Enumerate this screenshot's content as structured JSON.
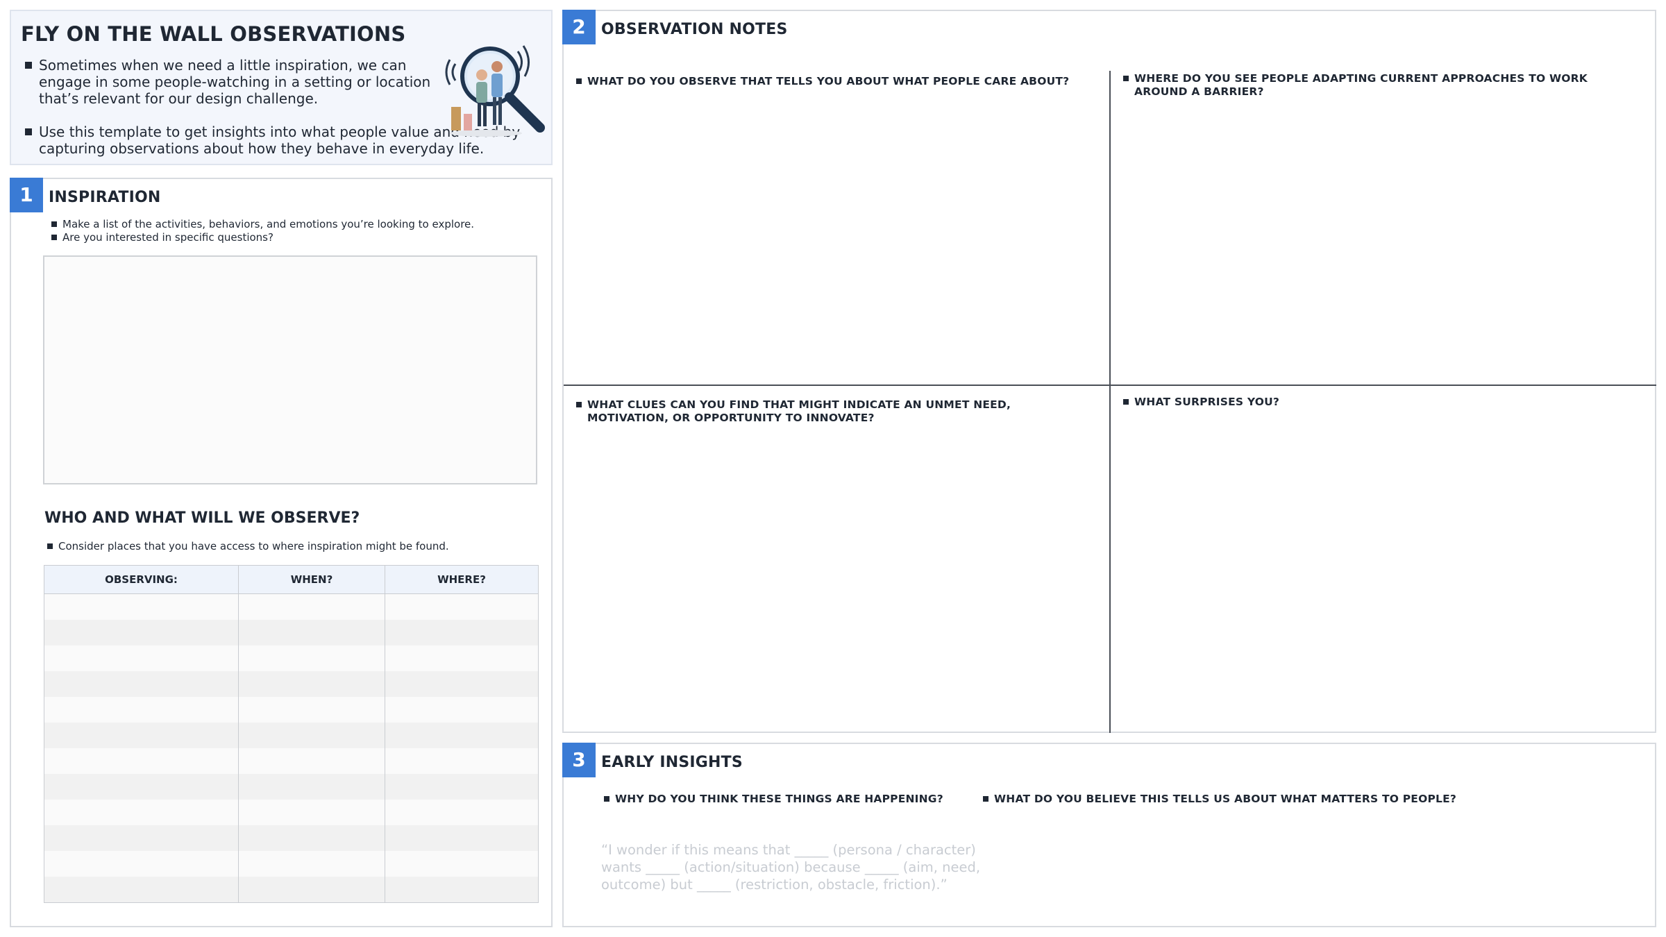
{
  "intro": {
    "title": "FLY ON THE WALL OBSERVATIONS",
    "bullets": [
      "Sometimes when we need a little inspiration, we can engage in some people-watching in a setting or location that’s relevant for our design challenge.",
      "Use this template to get insights into what people value and need by capturing observations about how they behave in everyday life."
    ],
    "illustration_icon": "magnifying-glass-people-icon"
  },
  "section1": {
    "number": "1",
    "title": "INSPIRATION",
    "bullets": [
      "Make a list of the activities, behaviors, and emotions you’re looking to explore.",
      "Are you interested in specific questions?"
    ],
    "who_title": "WHO AND WHAT WILL WE OBSERVE?",
    "who_bullet": "Consider places that you have access to where inspiration might be found.",
    "table": {
      "columns": [
        "OBSERVING:",
        "WHEN?",
        "WHERE?"
      ],
      "row_count": 12
    }
  },
  "section2": {
    "number": "2",
    "title": "OBSERVATION NOTES",
    "questions": [
      "WHAT DO YOU OBSERVE THAT TELLS YOU ABOUT WHAT PEOPLE CARE ABOUT?",
      "WHERE DO YOU SEE PEOPLE ADAPTING CURRENT APPROACHES TO WORK AROUND A BARRIER?",
      "WHAT CLUES CAN YOU FIND THAT MIGHT INDICATE AN UNMET NEED, MOTIVATION, OR OPPORTUNITY TO INNOVATE?",
      "WHAT SURPRISES YOU?"
    ]
  },
  "section3": {
    "number": "3",
    "title": "EARLY INSIGHTS",
    "questions": [
      "WHY DO YOU THINK THESE THINGS ARE HAPPENING?",
      "WHAT DO YOU BELIEVE THIS TELLS US ABOUT WHAT MATTERS TO PEOPLE?"
    ],
    "hint": "“I wonder if this means that _____ (persona / character) wants _____ (action/situation) because _____ (aim, need, outcome) but _____ (restriction, obstacle, friction).”"
  },
  "colors": {
    "accent": "#3a7bd5",
    "intro_bg": "#f3f6fc",
    "table_header_bg": "#eef3fb"
  }
}
